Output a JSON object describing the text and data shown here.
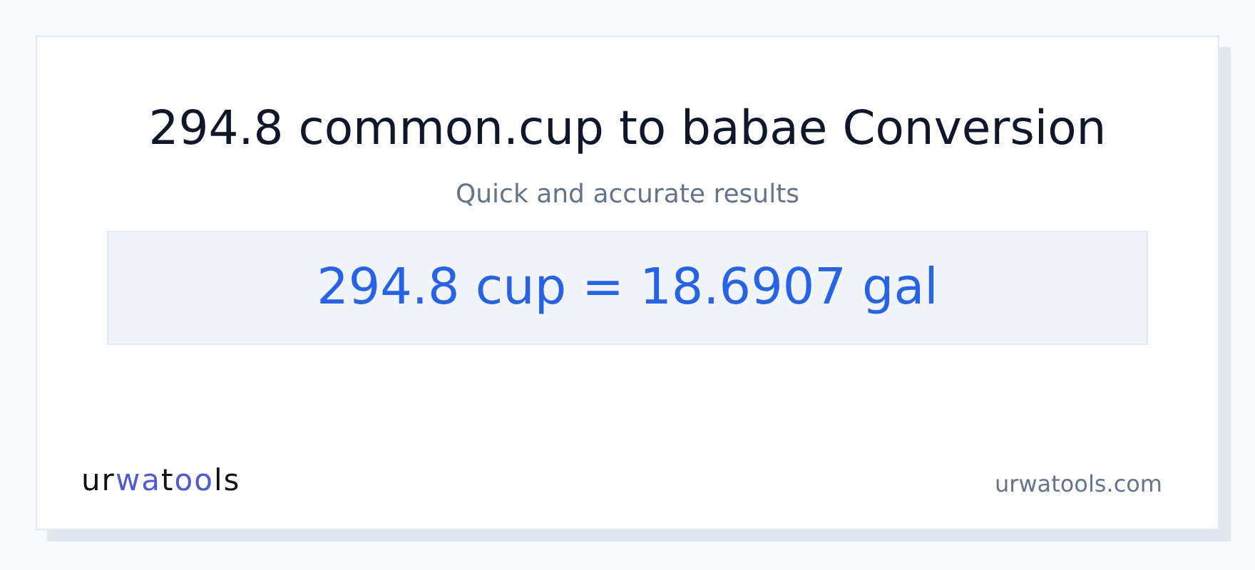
{
  "title": "294.8 common.cup to babae Conversion",
  "subtitle": "Quick and accurate results",
  "result": "294.8 cup = 18.6907 gal",
  "logo": [
    {
      "text": "ur",
      "highlight": false
    },
    {
      "text": "wa",
      "highlight": true
    },
    {
      "text": "t",
      "highlight": false
    },
    {
      "text": "oo",
      "highlight": true
    },
    {
      "text": "ls",
      "highlight": false
    }
  ],
  "site": "urwatools.com"
}
